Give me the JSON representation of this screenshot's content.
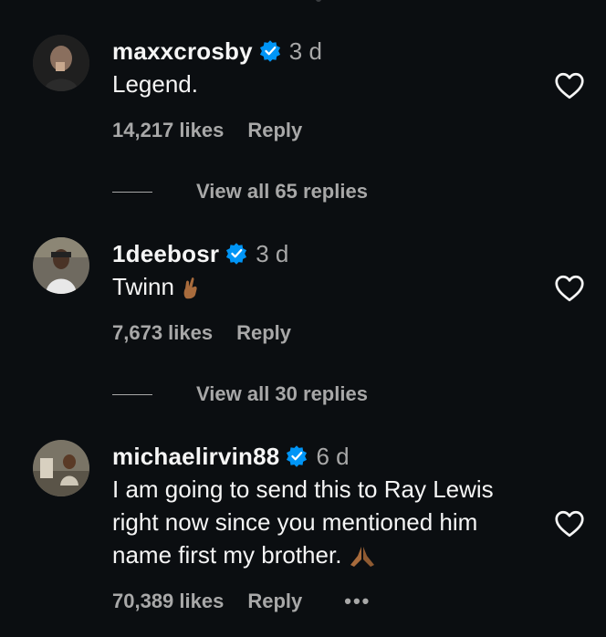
{
  "comments": [
    {
      "username": "maxxcrosby",
      "time": "3 d",
      "text": "Legend.",
      "likes": "14,217 likes",
      "reply": "Reply",
      "view_replies": "View all 65 replies"
    },
    {
      "username": "1deebosr",
      "time": "3 d",
      "text": "Twinn",
      "likes": "7,673 likes",
      "reply": "Reply",
      "view_replies": "View all 30 replies"
    },
    {
      "username": "michaelirvin88",
      "time": "6 d",
      "text": "I am going to send this to Ray Lewis right now since you mentioned him name first my brother.",
      "likes": "70,389 likes",
      "reply": "Reply",
      "more": "•••"
    }
  ],
  "colors": {
    "background": "#0b0e11",
    "text": "#f5f5f5",
    "muted": "#a8a8a8",
    "verified": "#0095f6"
  },
  "icons": [
    "verified-badge-icon",
    "heart-icon",
    "crossed-fingers-emoji",
    "praying-hands-emoji",
    "more-icon"
  ]
}
